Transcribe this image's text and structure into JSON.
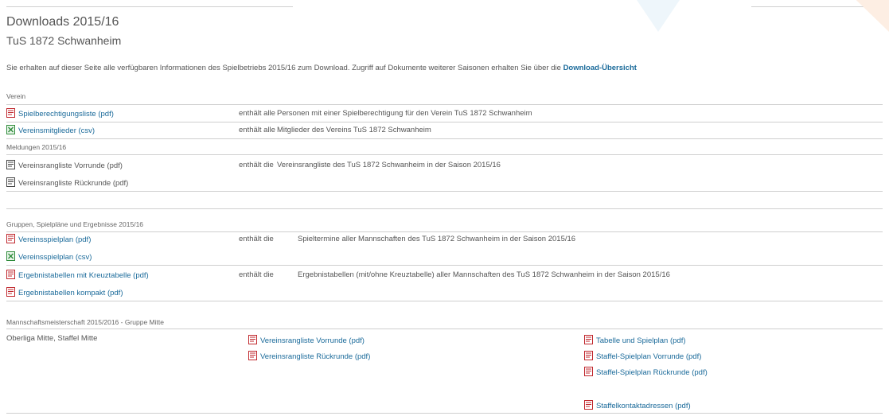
{
  "header": {
    "title": "Downloads 2015/16",
    "club": "TuS 1872 Schwanheim",
    "intro": "Sie erhalten auf dieser Seite alle verfügbaren Informationen des Spielbetriebs 2015/16 zum Download. Zugriff auf Dokumente weiterer Saisonen erhalten Sie über die",
    "overview_link": "Download-Übersicht"
  },
  "sections": {
    "verein": "Verein",
    "meldungen": "Meldungen 2015/16",
    "gruppen": "Gruppen, Spielpläne und Ergebnisse 2015/16",
    "mannschaft": "Mannschaftsmeisterschaft 2015/2016 - Gruppe Mitte"
  },
  "verein": {
    "row1": {
      "link": "Spielberechtigungsliste (pdf)",
      "prefix": "enthält alle",
      "desc": "Personen mit einer Spielberechtigung für den Verein TuS 1872 Schwanheim",
      "icon": "pdf-icon"
    },
    "row2": {
      "link": "Vereinsmitglieder (csv)",
      "prefix": "enthält alle",
      "desc": "Mitglieder des Vereins TuS 1872 Schwanheim",
      "icon": "csv-icon"
    }
  },
  "meldungen": {
    "row1": {
      "item": "Vereinsrangliste Vorrunde (pdf)",
      "prefix": "enthält die",
      "desc": "Vereinsrangliste des TuS 1872 Schwanheim  in der Saison 2015/16",
      "icon": "pdf-gray-icon"
    },
    "row2": {
      "item": "Vereinsrangliste Rückrunde (pdf)",
      "icon": "pdf-gray-icon"
    }
  },
  "gruppen": {
    "row1": {
      "link": "Vereinsspielplan (pdf)",
      "prefix": "enthält die",
      "desc": "Spieltermine aller Mannschaften des TuS 1872 Schwanheim  in der Saison 2015/16"
    },
    "row2": {
      "link": "Vereinsspielplan (csv)"
    },
    "row3": {
      "link": "Ergebnistabellen mit Kreuztabelle (pdf)",
      "prefix": "enthält die",
      "desc": "Ergebnistabellen (mit/ohne Kreuztabelle) aller Mannschaften des TuS 1872 Schwanheim  in der Saison 2015/16"
    },
    "row4": {
      "link": "Ergebnistabellen kompakt (pdf)"
    }
  },
  "mannschaft": {
    "league": "Oberliga Mitte, Staffel Mitte",
    "mid": {
      "vor_a": "Verei",
      "vor_b": "nsrangliste Vorrunde (pdf)",
      "rueck_a": "Verei",
      "rueck_b": "nsrangliste Rückrunde (pdf)"
    },
    "right": {
      "tabelle": "Tabelle und Spielplan (pdf)",
      "vorrunde": "Staffel-Spielplan Vorrunde (pdf)",
      "rueckrunde": "Staffel-Spielplan Rückrunde (pdf)",
      "kontakt": "Staffelkontaktadressen (pdf)"
    }
  },
  "colors": {
    "link": "#1a6a9a",
    "pdf": "#c0272d",
    "csv": "#2e8b3a",
    "text": "#555555"
  }
}
